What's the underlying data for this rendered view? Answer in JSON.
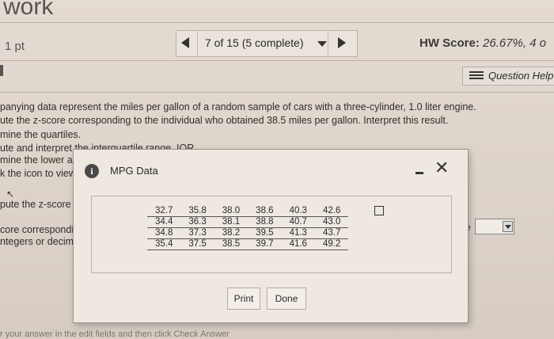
{
  "header": {
    "title": "work",
    "points": "1 pt",
    "progress": "7 of 15 (5 complete)",
    "hw_score_label": "HW Score:",
    "hw_score_value": "26.67%, 4 o"
  },
  "toolbar": {
    "question_help": "Question Help"
  },
  "question": {
    "lines": [
      "panying data represent the miles per gallon of a random sample of cars with a three-cylinder, 1.0 liter engine.",
      "ute the z-score corresponding to the individual who obtained 38.5 miles per gallon. Interpret this result.",
      "mine the quartiles.",
      "ute and interpret the interquartile range, IQR.",
      "mine the lower a",
      "k the icon to view",
      "pute the z-score c",
      "core corresponding",
      "ntegers or decimals"
    ],
    "the_label": "the",
    "footer_cut": "r your answer in the edit fields and then click Check Answer"
  },
  "modal": {
    "title": "MPG Data",
    "info_icon": "i",
    "close_icon": "✕",
    "table": [
      [
        "32.7",
        "35.8",
        "38.0",
        "38.6",
        "40.3",
        "42.6"
      ],
      [
        "34.4",
        "36.3",
        "38.1",
        "38.8",
        "40.7",
        "43.0"
      ],
      [
        "34.8",
        "37.3",
        "38.2",
        "39.5",
        "41.3",
        "43.7"
      ],
      [
        "35.4",
        "37.5",
        "38.5",
        "39.7",
        "41.6",
        "49.2"
      ]
    ],
    "print_label": "Print",
    "done_label": "Done"
  }
}
